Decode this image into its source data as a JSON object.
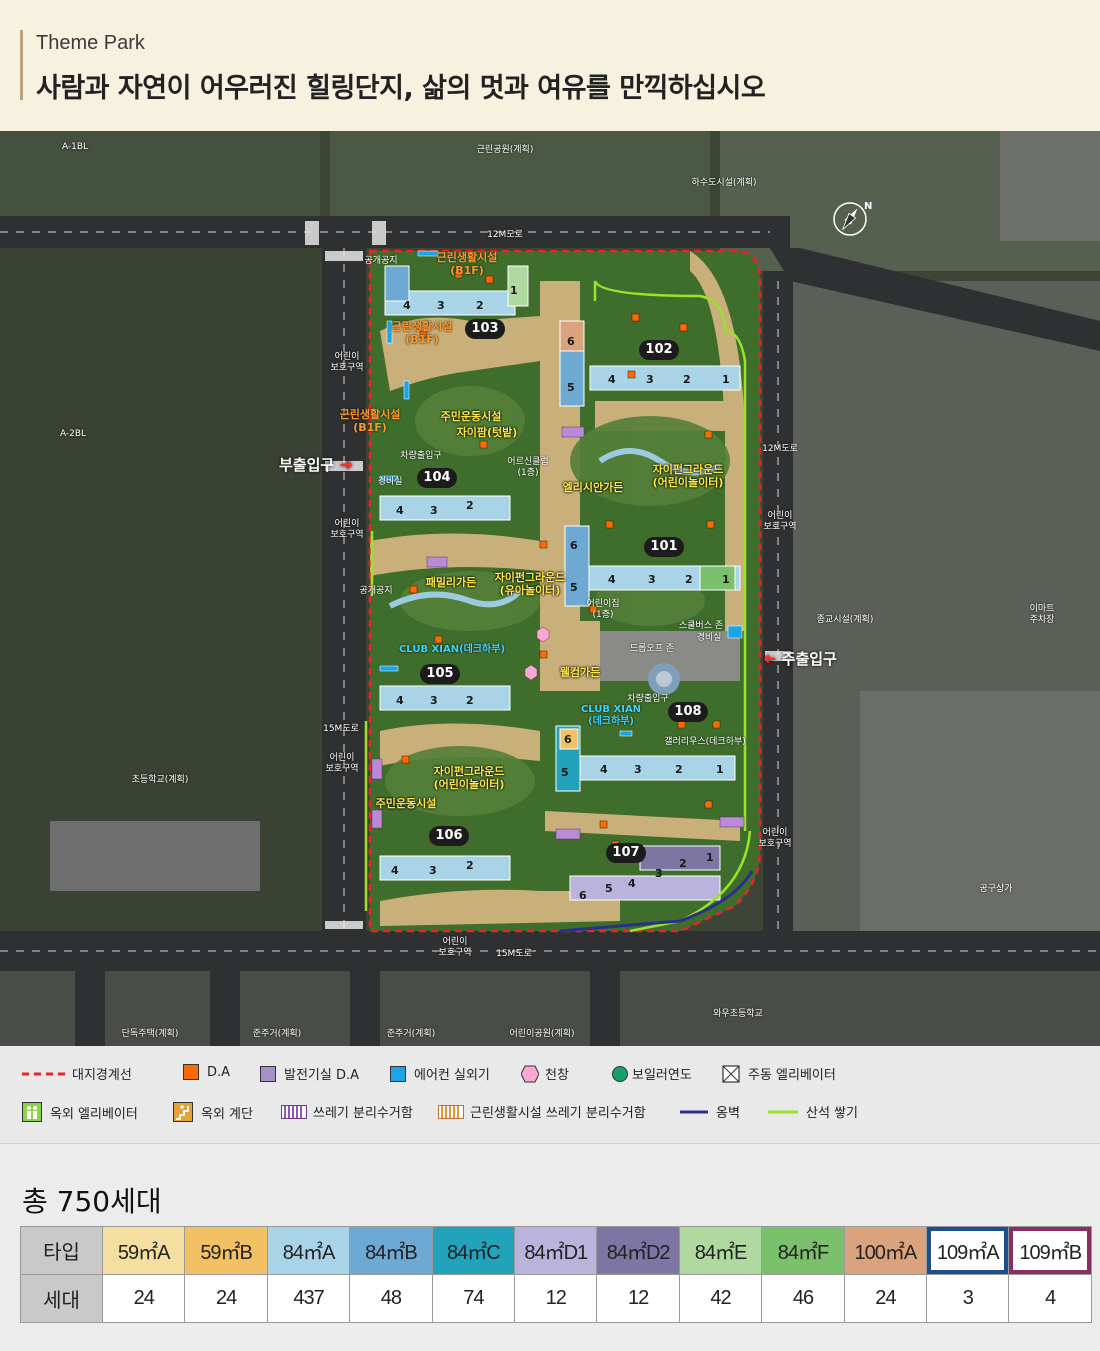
{
  "header": {
    "eyebrow": "Theme Park",
    "headline": "사람과 자연이 어우러진 힐링단지, 삶의 멋과 여유를 만끽하십시오"
  },
  "map": {
    "surroundings": [
      {
        "id": "a1bl",
        "text": "A-1BL"
      },
      {
        "id": "park",
        "text": "근린공원(계획)"
      },
      {
        "id": "sewage",
        "text": "하수도시설(계획)"
      },
      {
        "id": "road12n",
        "text": "12M도로"
      },
      {
        "id": "a2bl",
        "text": "A-2BL"
      },
      {
        "id": "road12e",
        "text": "12M도로"
      },
      {
        "id": "religion",
        "text": "종교시설(계획)"
      },
      {
        "id": "emart",
        "text": "이마트\n주차장"
      },
      {
        "id": "road15w",
        "text": "15M도로"
      },
      {
        "id": "school",
        "text": "초등학교(계획)"
      },
      {
        "id": "shops",
        "text": "공구상가"
      },
      {
        "id": "road15s",
        "text": "15M도로"
      },
      {
        "id": "detached",
        "text": "단독주택(계획)"
      },
      {
        "id": "semires1",
        "text": "준주거(계획)"
      },
      {
        "id": "semires2",
        "text": "준주거(계획)"
      },
      {
        "id": "kidpark",
        "text": "어린이공원(계획)"
      },
      {
        "id": "waw",
        "text": "와우초등학교"
      }
    ],
    "zones": [
      {
        "id": "z1",
        "text": "어린이\n보호구역"
      },
      {
        "id": "z2",
        "text": "어린이\n보호구역"
      },
      {
        "id": "z3",
        "text": "어린이\n보호구역"
      },
      {
        "id": "z4",
        "text": "어린이\n보호구역"
      },
      {
        "id": "z5",
        "text": "어린이\n보호구역"
      },
      {
        "id": "z6",
        "text": "어린이\n보호구역"
      }
    ],
    "buildings": [
      {
        "id": "b103",
        "text": "103"
      },
      {
        "id": "b102",
        "text": "102"
      },
      {
        "id": "b104",
        "text": "104"
      },
      {
        "id": "b101",
        "text": "101"
      },
      {
        "id": "b105",
        "text": "105"
      },
      {
        "id": "b108",
        "text": "108"
      },
      {
        "id": "b106",
        "text": "106"
      },
      {
        "id": "b107",
        "text": "107"
      }
    ],
    "facilities_yellow": [
      {
        "id": "fitness",
        "text": "주민운동시설"
      },
      {
        "id": "jaipam",
        "text": "자이팜(텃밭)"
      },
      {
        "id": "playground1",
        "text": "자이펀그라운드\n(어린이놀이터)"
      },
      {
        "id": "elysian",
        "text": "엘리시안가든"
      },
      {
        "id": "family",
        "text": "패밀리가든"
      },
      {
        "id": "playground2",
        "text": "자이펀그라운드\n(유아놀이터)"
      },
      {
        "id": "welcome",
        "text": "웰컴가든"
      },
      {
        "id": "playground3",
        "text": "자이펀그라운드\n(어린이놀이터)"
      },
      {
        "id": "fitness2",
        "text": "주민운동시설"
      }
    ],
    "facilities_orange": [
      {
        "id": "retail1",
        "text": "근린생활시설\n(B1F)"
      },
      {
        "id": "retail2",
        "text": "근린생활시설\n(B1F)"
      },
      {
        "id": "retail3",
        "text": "근린생활시설\n(B1F)"
      }
    ],
    "facilities_cyan": [
      {
        "id": "club1",
        "text": "CLUB XIAN(데크하부)"
      },
      {
        "id": "club2",
        "text": "CLUB XIAN\n(데크하부)"
      }
    ],
    "facilities_white": [
      {
        "id": "public1",
        "text": "공개공지"
      },
      {
        "id": "carin1",
        "text": "차량출입구"
      },
      {
        "id": "guard1",
        "text": "경비실"
      },
      {
        "id": "senior",
        "text": "어르신클럽\n(1층)"
      },
      {
        "id": "public2",
        "text": "공개공지"
      },
      {
        "id": "daycare",
        "text": "어린이집\n(1층)"
      },
      {
        "id": "bus",
        "text": "스쿨버스 존"
      },
      {
        "id": "guard2",
        "text": "경비실"
      },
      {
        "id": "dropoff",
        "text": "드롭오프 존"
      },
      {
        "id": "carin2",
        "text": "차량출입구"
      },
      {
        "id": "gallery",
        "text": "갤러리우스(데크하부)"
      }
    ],
    "entrances": {
      "sub": "부출입구",
      "main": "주출입구"
    },
    "colors": {
      "boundary": "#e8242a",
      "retaining_wall": "#2b2f8c",
      "stone_wall": "#9be22a",
      "landscape_green": "#3f6d2c",
      "path_sand": "#c9b07a"
    }
  },
  "legend": [
    {
      "id": "boundary",
      "label": "대지경계선",
      "icon": "dashed-red-line"
    },
    {
      "id": "da",
      "label": "D.A",
      "icon": "orange-square"
    },
    {
      "id": "gen-da",
      "label": "발전기실 D.A",
      "icon": "purple-square"
    },
    {
      "id": "ac",
      "label": "에어컨 실외기",
      "icon": "blue-square"
    },
    {
      "id": "skylight",
      "label": "천창",
      "icon": "pink-hexagon"
    },
    {
      "id": "boiler",
      "label": "보일러연도",
      "icon": "green-circle"
    },
    {
      "id": "elevator",
      "label": "주동 엘리베이터",
      "icon": "crossed-box"
    },
    {
      "id": "out-elev",
      "label": "옥외 엘리베이터",
      "icon": "green-elevator"
    },
    {
      "id": "out-stair",
      "label": "옥외 계단",
      "icon": "orange-stairs"
    },
    {
      "id": "trash",
      "label": "쓰레기 분리수거함",
      "icon": "purple-stripes"
    },
    {
      "id": "retail-trash",
      "label": "근린생활시설 쓰레기 분리수거함",
      "icon": "orange-stripes"
    },
    {
      "id": "wall",
      "label": "옹벽",
      "icon": "navy-line"
    },
    {
      "id": "stone",
      "label": "산석 쌓기",
      "icon": "lime-line"
    }
  ],
  "summary": {
    "total": "총 750세대",
    "type_header": "타입",
    "count_header": "세대",
    "units": [
      {
        "type": "59㎡A",
        "count": "24",
        "color": "#f4dfa0"
      },
      {
        "type": "59㎡B",
        "count": "24",
        "color": "#f1c164"
      },
      {
        "type": "84㎡A",
        "count": "437",
        "color": "#a9d4e7"
      },
      {
        "type": "84㎡B",
        "count": "48",
        "color": "#6da9d2"
      },
      {
        "type": "84㎡C",
        "count": "74",
        "color": "#22a3bb"
      },
      {
        "type": "84㎡D1",
        "count": "12",
        "color": "#bab3dc"
      },
      {
        "type": "84㎡D2",
        "count": "12",
        "color": "#7d76a3"
      },
      {
        "type": "84㎡E",
        "count": "42",
        "color": "#b0d9a0"
      },
      {
        "type": "84㎡F",
        "count": "46",
        "color": "#7bc06c"
      },
      {
        "type": "100㎡A",
        "count": "24",
        "color": "#d9a47d"
      },
      {
        "type": "109㎡A",
        "count": "3",
        "color": "#ffffff",
        "border": "#1f4e8c"
      },
      {
        "type": "109㎡B",
        "count": "4",
        "color": "#ffffff",
        "border": "#8a2f63"
      }
    ]
  }
}
